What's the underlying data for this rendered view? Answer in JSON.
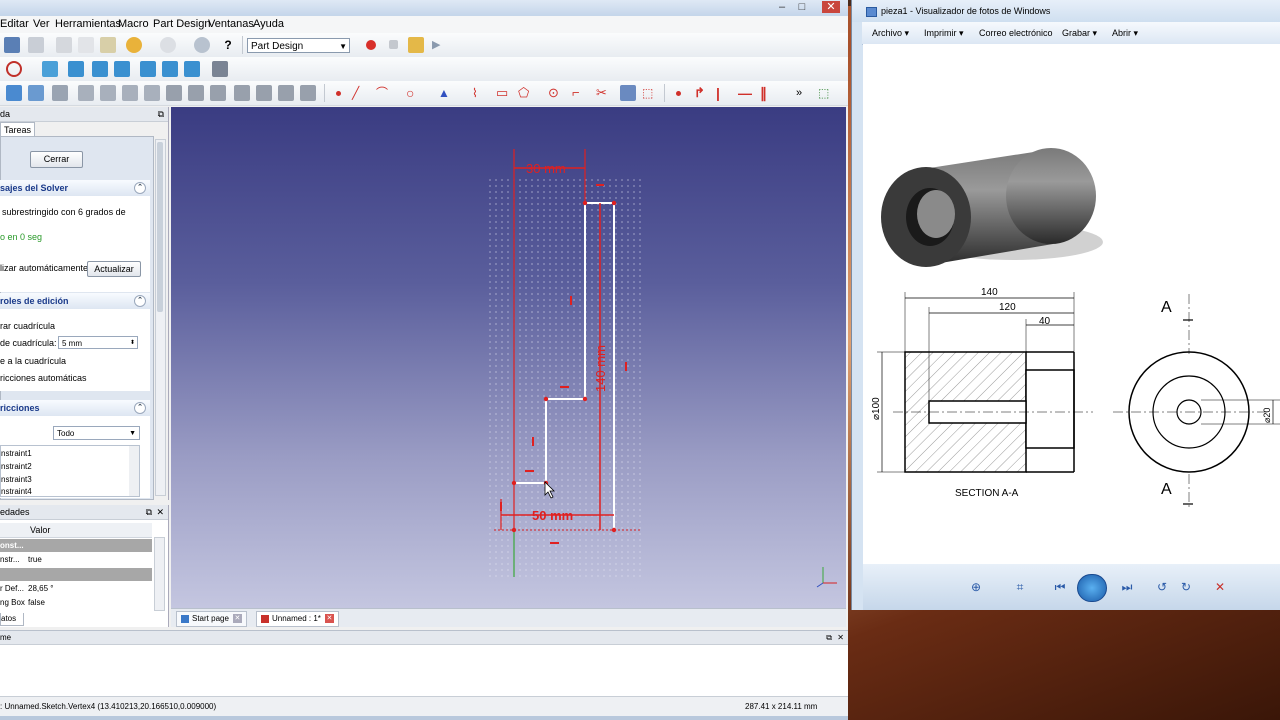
{
  "freecad": {
    "menu": [
      "Editar",
      "Ver",
      "Herramientas",
      "Macro",
      "Part Design",
      "Ventanas",
      "Ayuda"
    ],
    "workbench": "Part Design",
    "combo": {
      "header": "da",
      "tab": "Tareas",
      "close_label": "Cerrar",
      "solver": {
        "title": "sajes del Solver",
        "message": "subrestringido con 6 grados de",
        "time": "o en 0 seg",
        "auto_update": "lizar automáticamente",
        "update_label": "Actualizar"
      },
      "edit": {
        "title": "roles de edición",
        "show_grid": "rar cuadrícula",
        "grid_size_label": "de cuadrícula:",
        "grid_size_value": "5 mm",
        "snap": "e a la cuadrícula",
        "auto_constraints": "ricciones automáticas"
      },
      "constraints": {
        "title": "ricciones",
        "filter": "Todo",
        "items": [
          "nstraint1",
          "nstraint2",
          "nstraint3",
          "nstraint4"
        ]
      }
    },
    "properties": {
      "header": "edades",
      "col_value": "Valor",
      "group1": "onst...",
      "row1_key": "nstr...",
      "row1_value": "true",
      "row2_key": "r Def...",
      "row2_value": "28,65 °",
      "row3_key": "ng Box",
      "row3_value": "false",
      "tab": "atos"
    },
    "sketch": {
      "dim_top": "30 mm",
      "dim_vertical": "140 mm",
      "dim_bottom": "50 mm"
    },
    "doc_tabs": [
      "Start page",
      "Unnamed : 1*"
    ],
    "report_title": "me",
    "status_left": ": Unnamed.Sketch.Vertex4 (13.410213,20.166510,0.009000)",
    "status_right": "287.41 x 214.11 mm"
  },
  "photo_viewer": {
    "title": "pieza1 - Visualizador de fotos de Windows",
    "menu": [
      "Archivo",
      "Imprimir",
      "Correo electrónico",
      "Grabar",
      "Abrir"
    ],
    "drawing": {
      "dim_140": "140",
      "dim_120": "120",
      "dim_40": "40",
      "dim_d100": "⌀100",
      "dim_d20": "⌀20",
      "section_label": "SECTION A-A",
      "cut_a_top": "A",
      "cut_a_bottom": "A"
    }
  }
}
